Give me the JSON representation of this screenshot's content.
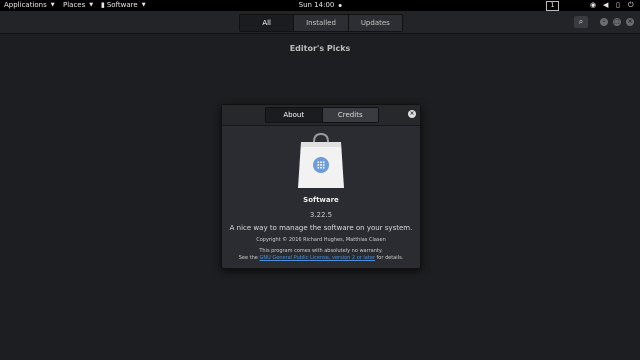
{
  "topbar": {
    "applications": "Applications",
    "places": "Places",
    "app_menu": "Software",
    "clock": "Sun 14:00",
    "workspace": "1"
  },
  "header": {
    "tabs": [
      {
        "label": "All",
        "active": true
      },
      {
        "label": "Installed",
        "active": false
      },
      {
        "label": "Updates",
        "active": false
      }
    ]
  },
  "main": {
    "section_title": "Editor's Picks"
  },
  "about_dialog": {
    "tabs": [
      {
        "label": "About",
        "active": true
      },
      {
        "label": "Credits",
        "active": false
      }
    ],
    "app_name": "Software",
    "version": "3.22.5",
    "description": "A nice way to manage the software on your system.",
    "copyright": "Copyright © 2016 Richard Hughes, Matthias Clasen",
    "warranty": "This program comes with absolutely no warranty.",
    "license_prefix": "See the",
    "license_link": "GNU General Public License, version 2 or later",
    "license_suffix": "for details."
  },
  "colors": {
    "background": "#1d1e21",
    "topbar": "#000000",
    "dialog": "#2b2c31",
    "link": "#4a90d9"
  },
  "icons": [
    "menu-caret-icon",
    "shopping-bag-icon",
    "search-icon",
    "close-icon",
    "minimize-icon",
    "maximize-icon",
    "network-icon",
    "volume-icon",
    "battery-icon",
    "power-icon"
  ]
}
